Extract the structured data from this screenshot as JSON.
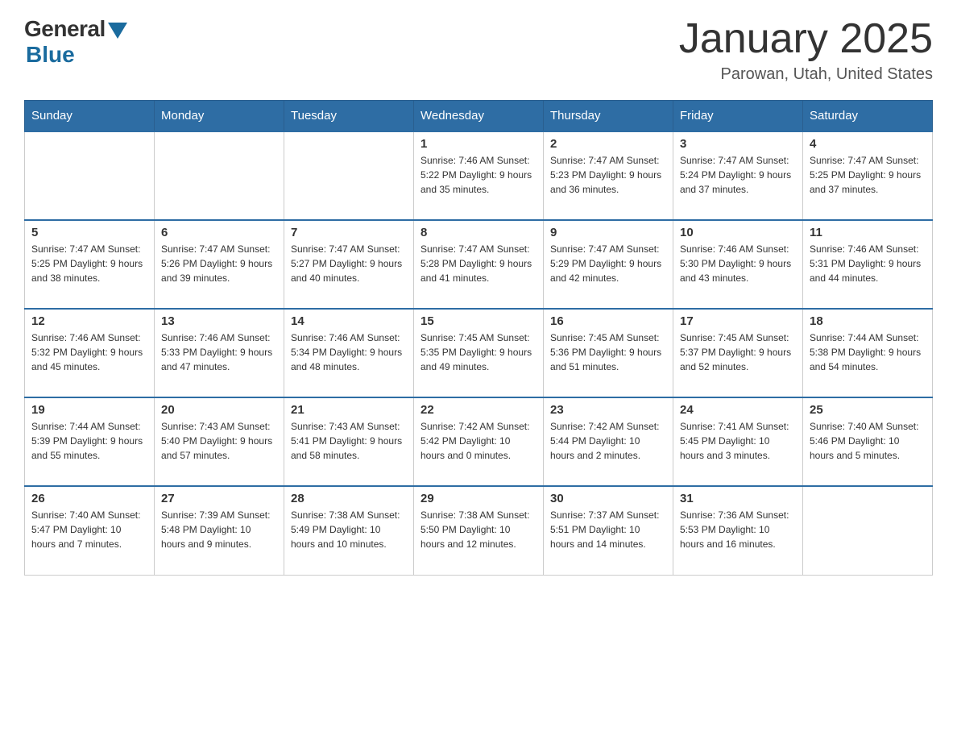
{
  "header": {
    "logo_general": "General",
    "logo_blue": "Blue",
    "title": "January 2025",
    "location": "Parowan, Utah, United States"
  },
  "calendar": {
    "days_of_week": [
      "Sunday",
      "Monday",
      "Tuesday",
      "Wednesday",
      "Thursday",
      "Friday",
      "Saturday"
    ],
    "weeks": [
      [
        {
          "day": "",
          "info": ""
        },
        {
          "day": "",
          "info": ""
        },
        {
          "day": "",
          "info": ""
        },
        {
          "day": "1",
          "info": "Sunrise: 7:46 AM\nSunset: 5:22 PM\nDaylight: 9 hours and 35 minutes."
        },
        {
          "day": "2",
          "info": "Sunrise: 7:47 AM\nSunset: 5:23 PM\nDaylight: 9 hours and 36 minutes."
        },
        {
          "day": "3",
          "info": "Sunrise: 7:47 AM\nSunset: 5:24 PM\nDaylight: 9 hours and 37 minutes."
        },
        {
          "day": "4",
          "info": "Sunrise: 7:47 AM\nSunset: 5:25 PM\nDaylight: 9 hours and 37 minutes."
        }
      ],
      [
        {
          "day": "5",
          "info": "Sunrise: 7:47 AM\nSunset: 5:25 PM\nDaylight: 9 hours and 38 minutes."
        },
        {
          "day": "6",
          "info": "Sunrise: 7:47 AM\nSunset: 5:26 PM\nDaylight: 9 hours and 39 minutes."
        },
        {
          "day": "7",
          "info": "Sunrise: 7:47 AM\nSunset: 5:27 PM\nDaylight: 9 hours and 40 minutes."
        },
        {
          "day": "8",
          "info": "Sunrise: 7:47 AM\nSunset: 5:28 PM\nDaylight: 9 hours and 41 minutes."
        },
        {
          "day": "9",
          "info": "Sunrise: 7:47 AM\nSunset: 5:29 PM\nDaylight: 9 hours and 42 minutes."
        },
        {
          "day": "10",
          "info": "Sunrise: 7:46 AM\nSunset: 5:30 PM\nDaylight: 9 hours and 43 minutes."
        },
        {
          "day": "11",
          "info": "Sunrise: 7:46 AM\nSunset: 5:31 PM\nDaylight: 9 hours and 44 minutes."
        }
      ],
      [
        {
          "day": "12",
          "info": "Sunrise: 7:46 AM\nSunset: 5:32 PM\nDaylight: 9 hours and 45 minutes."
        },
        {
          "day": "13",
          "info": "Sunrise: 7:46 AM\nSunset: 5:33 PM\nDaylight: 9 hours and 47 minutes."
        },
        {
          "day": "14",
          "info": "Sunrise: 7:46 AM\nSunset: 5:34 PM\nDaylight: 9 hours and 48 minutes."
        },
        {
          "day": "15",
          "info": "Sunrise: 7:45 AM\nSunset: 5:35 PM\nDaylight: 9 hours and 49 minutes."
        },
        {
          "day": "16",
          "info": "Sunrise: 7:45 AM\nSunset: 5:36 PM\nDaylight: 9 hours and 51 minutes."
        },
        {
          "day": "17",
          "info": "Sunrise: 7:45 AM\nSunset: 5:37 PM\nDaylight: 9 hours and 52 minutes."
        },
        {
          "day": "18",
          "info": "Sunrise: 7:44 AM\nSunset: 5:38 PM\nDaylight: 9 hours and 54 minutes."
        }
      ],
      [
        {
          "day": "19",
          "info": "Sunrise: 7:44 AM\nSunset: 5:39 PM\nDaylight: 9 hours and 55 minutes."
        },
        {
          "day": "20",
          "info": "Sunrise: 7:43 AM\nSunset: 5:40 PM\nDaylight: 9 hours and 57 minutes."
        },
        {
          "day": "21",
          "info": "Sunrise: 7:43 AM\nSunset: 5:41 PM\nDaylight: 9 hours and 58 minutes."
        },
        {
          "day": "22",
          "info": "Sunrise: 7:42 AM\nSunset: 5:42 PM\nDaylight: 10 hours and 0 minutes."
        },
        {
          "day": "23",
          "info": "Sunrise: 7:42 AM\nSunset: 5:44 PM\nDaylight: 10 hours and 2 minutes."
        },
        {
          "day": "24",
          "info": "Sunrise: 7:41 AM\nSunset: 5:45 PM\nDaylight: 10 hours and 3 minutes."
        },
        {
          "day": "25",
          "info": "Sunrise: 7:40 AM\nSunset: 5:46 PM\nDaylight: 10 hours and 5 minutes."
        }
      ],
      [
        {
          "day": "26",
          "info": "Sunrise: 7:40 AM\nSunset: 5:47 PM\nDaylight: 10 hours and 7 minutes."
        },
        {
          "day": "27",
          "info": "Sunrise: 7:39 AM\nSunset: 5:48 PM\nDaylight: 10 hours and 9 minutes."
        },
        {
          "day": "28",
          "info": "Sunrise: 7:38 AM\nSunset: 5:49 PM\nDaylight: 10 hours and 10 minutes."
        },
        {
          "day": "29",
          "info": "Sunrise: 7:38 AM\nSunset: 5:50 PM\nDaylight: 10 hours and 12 minutes."
        },
        {
          "day": "30",
          "info": "Sunrise: 7:37 AM\nSunset: 5:51 PM\nDaylight: 10 hours and 14 minutes."
        },
        {
          "day": "31",
          "info": "Sunrise: 7:36 AM\nSunset: 5:53 PM\nDaylight: 10 hours and 16 minutes."
        },
        {
          "day": "",
          "info": ""
        }
      ]
    ]
  }
}
